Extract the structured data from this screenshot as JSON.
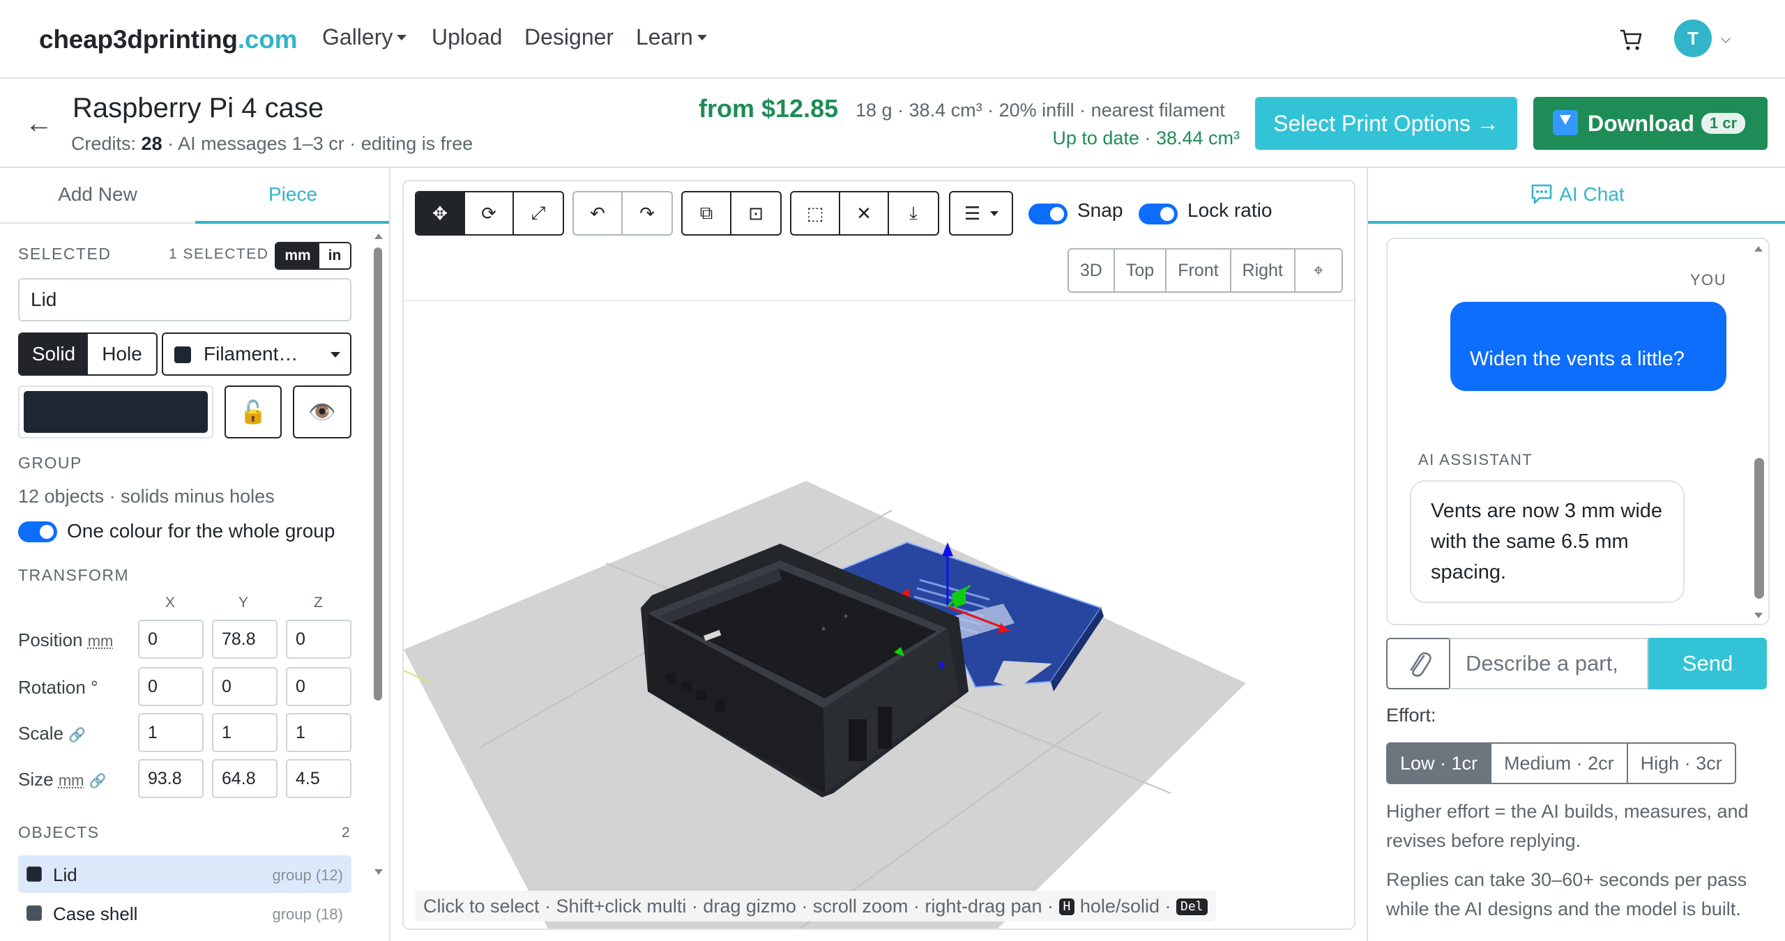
{
  "nav": {
    "brand_main": "cheap3dprinting",
    "brand_tld": ".com",
    "links": [
      {
        "label": "Gallery",
        "dropdown": true
      },
      {
        "label": "Upload",
        "dropdown": false
      },
      {
        "label": "Designer",
        "dropdown": false
      },
      {
        "label": "Learn",
        "dropdown": true
      }
    ],
    "avatar_initial": "T"
  },
  "header": {
    "back": "←",
    "title": "Raspberry Pi 4 case",
    "credits_label": "Credits:",
    "credits_value": "28",
    "credits_note": "· AI messages 1–3 cr · editing is free",
    "price": "from $12.85",
    "specs": "18 g · 38.4 cm³ · 20% infill · nearest filament",
    "status": "Up to date · 38.44 cm³",
    "print_button": "Select Print Options →",
    "download_button": "Download",
    "download_badge": "1 cr"
  },
  "left": {
    "tabs": [
      "Add New",
      "Piece"
    ],
    "active_tab": "Piece",
    "selected_label": "SELECTED",
    "selected_count": "1 SELECTED",
    "units": [
      "mm",
      "in"
    ],
    "active_unit": "mm",
    "name_value": "Lid",
    "mode": [
      "Solid",
      "Hole"
    ],
    "active_mode": "Solid",
    "filament_label": "Filament…",
    "color": "#1e2633",
    "lock_icon": "🔓",
    "eye_icon": "👁️",
    "group_label": "GROUP",
    "group_info": "12 objects · solids minus holes",
    "group_color_toggle": "One colour for the whole group",
    "transform_label": "TRANSFORM",
    "axes": [
      "X",
      "Y",
      "Z"
    ],
    "rows": [
      {
        "label": "Position",
        "unit": "mm",
        "values": [
          "0",
          "78.8",
          "0"
        ]
      },
      {
        "label": "Rotation °",
        "unit": "",
        "values": [
          "0",
          "0",
          "0"
        ]
      },
      {
        "label": "Scale",
        "unit": "",
        "values": [
          "1",
          "1",
          "1"
        ]
      },
      {
        "label": "Size",
        "unit": "mm",
        "values": [
          "93.8",
          "64.8",
          "4.5"
        ]
      }
    ],
    "objects_label": "OBJECTS",
    "objects_count": "2",
    "objects": [
      {
        "name": "Lid",
        "group": "group (12)",
        "color": "#1e2633"
      },
      {
        "name": "Case shell",
        "group": "group (18)",
        "color": "#4a5260"
      }
    ]
  },
  "viewport": {
    "tools_transform": [
      "✥",
      "⟳",
      "⤢"
    ],
    "tools_history": [
      "↶",
      "↷"
    ],
    "tools_edit": [
      "⧉",
      "⊡"
    ],
    "tools_arrange": [
      "⬚",
      "✕",
      "⤓"
    ],
    "menu_icon": "☰",
    "snap_label": "Snap",
    "lock_ratio_label": "Lock ratio",
    "views": [
      "3D",
      "Top",
      "Front",
      "Right",
      "⌖"
    ],
    "hint": "Click to select · Shift+click multi · drag gizmo · scroll zoom · right-drag pan ·",
    "hint_key_h": "H",
    "hint_hole": "hole/solid ·",
    "hint_key_del": "Del"
  },
  "chat": {
    "tab_label": "AI Chat",
    "you_label": "YOU",
    "user_message": "Widen the vents a little?",
    "ai_label": "AI ASSISTANT",
    "ai_message": "Vents are now 3 mm wide with the same 6.5 mm spacing.",
    "input_placeholder": "Describe a part,",
    "send_label": "Send",
    "effort_label": "Effort:",
    "effort_options": [
      "Low · 1cr",
      "Medium · 2cr",
      "High · 3cr"
    ],
    "active_effort": "Low · 1cr",
    "help_1": "Higher effort = the AI builds, measures, and revises before replying.",
    "help_2": "Replies can take 30–60+ seconds per pass while the AI designs and the model is built."
  },
  "colors": {
    "accent": "#33b5c9",
    "green": "#1e8c56",
    "blue": "#0d6efd",
    "lid_blue": "#2846a0",
    "case_dark": "#2b2e33"
  }
}
